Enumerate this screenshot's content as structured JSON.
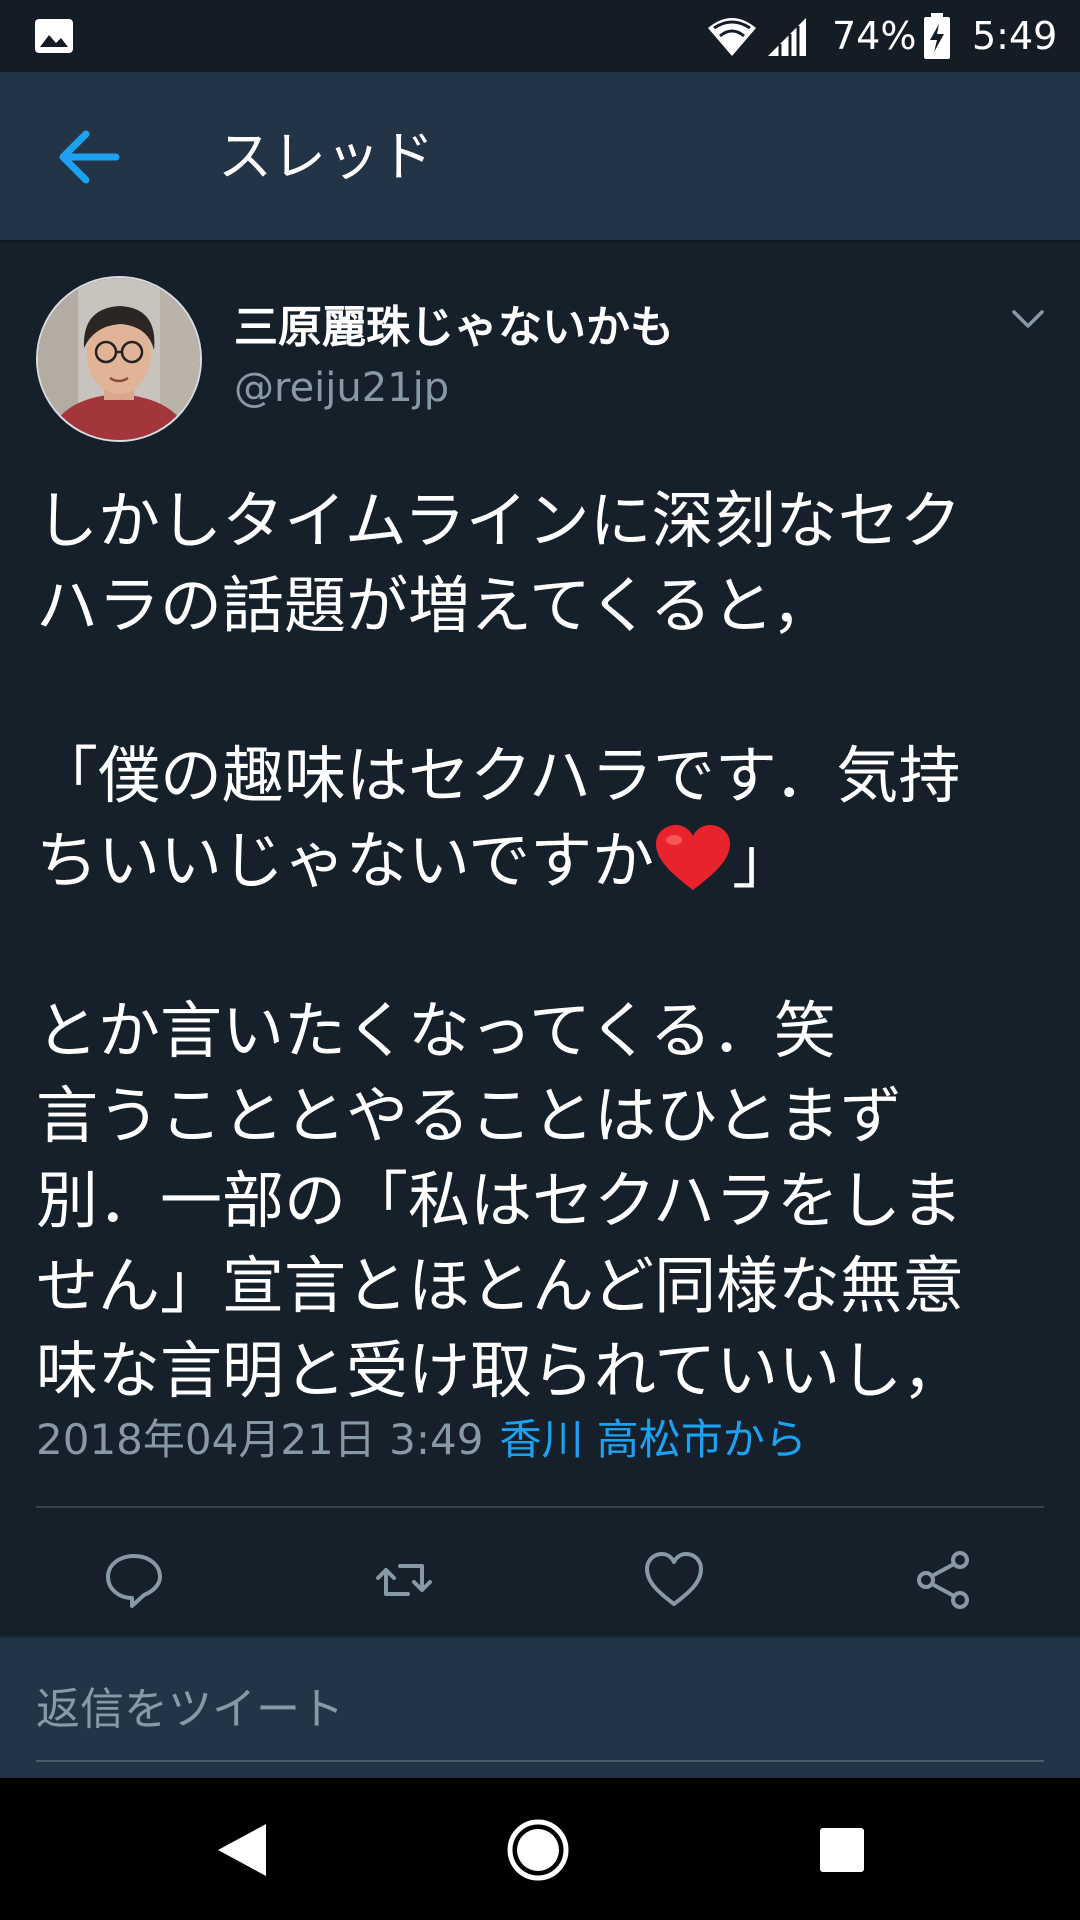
{
  "status_bar": {
    "battery": "74%",
    "time": "5:49"
  },
  "header": {
    "title": "スレッド"
  },
  "tweet": {
    "display_name": "三原麗珠じゃないかも",
    "handle": "@reiju21jp",
    "lines": {
      "l1": "しかしタイムラインに深刻なセク",
      "l2": "ハラの話題が増えてくると，",
      "l3": "「僕の趣味はセクハラです．気持",
      "l4": "ちいいじゃないですか",
      "l4_end": "」",
      "l5": "とか言いたくなってくる．笑",
      "l6": "言うこととやることはひとまず",
      "l7": "別．一部の「私はセクハラをしま",
      "l8": "せん」宣言とほとんど同様な無意",
      "l9": "味な言明と受け取られていいし，"
    },
    "timestamp": "2018年04月21日 3:49",
    "location": "香川 高松市から"
  },
  "reply": {
    "placeholder": "返信をツイート"
  },
  "icons": {
    "back": "arrow-left-icon",
    "caret": "chevron-down-icon",
    "reply": "comment-icon",
    "retweet": "retweet-icon",
    "like": "heart-icon",
    "share": "share-icon",
    "emoji": "red-heart-emoji"
  },
  "colors": {
    "background": "#15202b",
    "header": "#243447",
    "accent": "#1da1f2",
    "muted": "#8899a6"
  }
}
